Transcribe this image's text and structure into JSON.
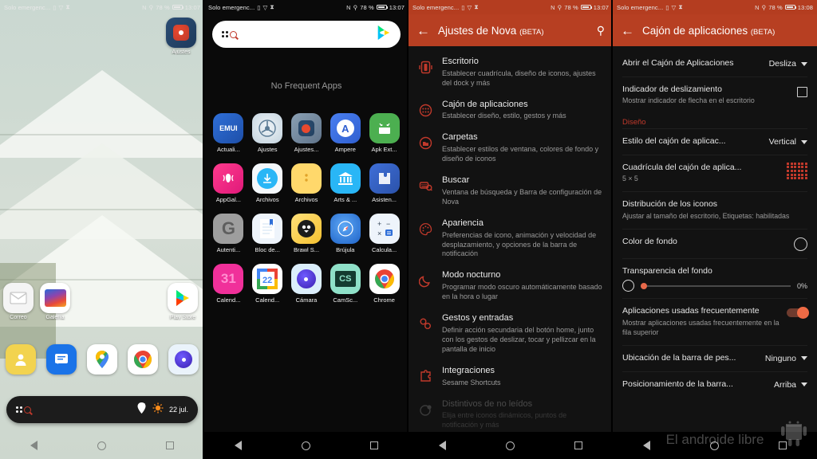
{
  "status_bars": [
    {
      "carrier": "Solo emergenc...",
      "battery": "78 %",
      "time": "13:07"
    },
    {
      "carrier": "Solo emergenc...",
      "battery": "78 %",
      "time": "13:07"
    },
    {
      "carrier": "Solo emergenc...",
      "battery": "78 %",
      "time": "13:07"
    },
    {
      "carrier": "Solo emergenc...",
      "battery": "78 %",
      "time": "13:08"
    }
  ],
  "home": {
    "top_icon": {
      "label": "Ajustes",
      "icon": "nova-settings-icon"
    },
    "row_icons": [
      {
        "label": "Correo",
        "icon": "mail-icon"
      },
      {
        "label": "Galería",
        "icon": "gallery-icon"
      },
      {
        "label": "Play Store",
        "icon": "play-store-icon"
      }
    ],
    "dock": [
      {
        "label": "Contactos",
        "icon": "contacts-icon"
      },
      {
        "label": "Mensajes",
        "icon": "messages-icon"
      },
      {
        "label": "Maps",
        "icon": "maps-icon"
      },
      {
        "label": "Chrome",
        "icon": "chrome-icon"
      },
      {
        "label": "Cámara",
        "icon": "camera-icon"
      }
    ],
    "search_widget": {
      "left_icon": "grid-search-icon",
      "location_icon": "location-off-icon",
      "weather_icon": "sun-icon",
      "date": "22 jul."
    }
  },
  "drawer": {
    "search": {
      "placeholder": "",
      "left_icon": "grid-search-icon",
      "right_icon": "play-store-icon"
    },
    "no_frequent": "No Frequent Apps",
    "apps": [
      {
        "label": "Actuali...",
        "icon": "emui-updater-icon",
        "glyph": "EMUI"
      },
      {
        "label": "Ajustes",
        "icon": "settings-icon",
        "glyph": ""
      },
      {
        "label": "Ajustes...",
        "icon": "nova-settings-icon",
        "glyph": ""
      },
      {
        "label": "Ampere",
        "icon": "ampere-icon",
        "glyph": "A"
      },
      {
        "label": "Apk Ext...",
        "icon": "apk-extractor-icon",
        "glyph": ""
      },
      {
        "label": "AppGal...",
        "icon": "huawei-appgallery-icon",
        "glyph": ""
      },
      {
        "label": "Archivos",
        "icon": "files-download-icon",
        "glyph": ""
      },
      {
        "label": "Archivos",
        "icon": "files-folder-icon",
        "glyph": ""
      },
      {
        "label": "Arts & ...",
        "icon": "arts-culture-icon",
        "glyph": ""
      },
      {
        "label": "Asisten...",
        "icon": "assistant-puzzle-icon",
        "glyph": ""
      },
      {
        "label": "Autenti...",
        "icon": "google-authenticator-icon",
        "glyph": "G"
      },
      {
        "label": "Bloc de...",
        "icon": "notepad-icon",
        "glyph": ""
      },
      {
        "label": "Brawl S...",
        "icon": "brawl-stars-icon",
        "glyph": ""
      },
      {
        "label": "Brújula",
        "icon": "compass-icon",
        "glyph": ""
      },
      {
        "label": "Calcula...",
        "icon": "calculator-icon",
        "glyph": ""
      },
      {
        "label": "Calend...",
        "icon": "huawei-calendar-icon",
        "glyph": "31"
      },
      {
        "label": "Calend...",
        "icon": "google-calendar-icon",
        "glyph": "22"
      },
      {
        "label": "Cámara",
        "icon": "camera-icon",
        "glyph": ""
      },
      {
        "label": "CamSc...",
        "icon": "camscanner-icon",
        "glyph": "CS"
      },
      {
        "label": "Chrome",
        "icon": "chrome-icon",
        "glyph": ""
      }
    ]
  },
  "nova_settings": {
    "title": "Ajustes de Nova",
    "title_beta": "(BETA)",
    "back_icon": "back-arrow-icon",
    "search_icon": "search-icon",
    "items": [
      {
        "title": "Escritorio",
        "sub": "Establecer cuadrícula, diseño de iconos, ajustes del dock y más",
        "icon": "desktop-icon"
      },
      {
        "title": "Cajón de aplicaciones",
        "sub": "Establecer diseño, estilo, gestos y más",
        "icon": "app-drawer-icon"
      },
      {
        "title": "Carpetas",
        "sub": "Establecer estilos de ventana, colores de fondo y diseño de iconos",
        "icon": "folder-icon"
      },
      {
        "title": "Buscar",
        "sub": "Ventana de búsqueda y Barra de configuración de Nova",
        "icon": "search-settings-icon"
      },
      {
        "title": "Apariencia",
        "sub": "Preferencias de icono, animación y velocidad de desplazamiento, y opciones de la barra de notificación",
        "icon": "palette-icon"
      },
      {
        "title": "Modo nocturno",
        "sub": "Programar modo oscuro automáticamente basado en la hora o lugar",
        "icon": "moon-icon"
      },
      {
        "title": "Gestos y entradas",
        "sub": "Definir acción secundaria del botón home, junto con los gestos de deslizar, tocar y pellizcar en la pantalla de inicio",
        "icon": "gestures-icon"
      },
      {
        "title": "Integraciones",
        "sub": "Sesame Shortcuts",
        "icon": "puzzle-icon"
      },
      {
        "title": "Distintivos de no leídos",
        "sub": "Elija entre iconos dinámicos, puntos de notificación y más",
        "icon": "badge-icon"
      }
    ]
  },
  "drawer_settings": {
    "title": "Cajón de aplicaciones",
    "title_beta": "(BETA)",
    "back_icon": "back-arrow-icon",
    "section_design": "Diseño",
    "rows": [
      {
        "type": "select",
        "title": "Abrir el Cajón de Aplicaciones",
        "sub": "",
        "value": "Desliza"
      },
      {
        "type": "checkbox",
        "title": "Indicador de deslizamiento",
        "sub": "Mostrar indicador de flecha en el escritorio",
        "value": ""
      },
      {
        "type": "select",
        "title": "Estilo del cajón de aplicac...",
        "sub": "",
        "value": "Vertical"
      },
      {
        "type": "grid",
        "title": "Cuadrícula del cajón de aplica...",
        "sub": "5 × 5",
        "value": ""
      },
      {
        "type": "plain",
        "title": "Distribución de los iconos",
        "sub": "Ajustar al tamaño del escritorio, Etiquetas: habilitadas",
        "value": ""
      },
      {
        "type": "circle",
        "title": "Color de fondo",
        "sub": "",
        "value": ""
      },
      {
        "type": "slider",
        "title": "Transparencia del fondo",
        "sub": "",
        "value": "0%"
      },
      {
        "type": "toggle",
        "title": "Aplicaciones usadas frecuentemente",
        "sub": "Mostrar aplicaciones usadas frecuentemente en la fila superior",
        "value": ""
      },
      {
        "type": "select",
        "title": "Ubicación de la barra de pes...",
        "sub": "",
        "value": "Ninguno"
      },
      {
        "type": "select",
        "title": "Posicionamiento de la barra...",
        "sub": "",
        "value": "Arriba"
      }
    ]
  },
  "navigation": {
    "back": "back-triangle-icon",
    "home": "home-circle-icon",
    "recents": "recents-square-icon"
  },
  "watermark": "El androide libre",
  "colors": {
    "accent": "#c0392b",
    "appbar": "#b73f22",
    "toggle_on": "#ef6b45"
  }
}
